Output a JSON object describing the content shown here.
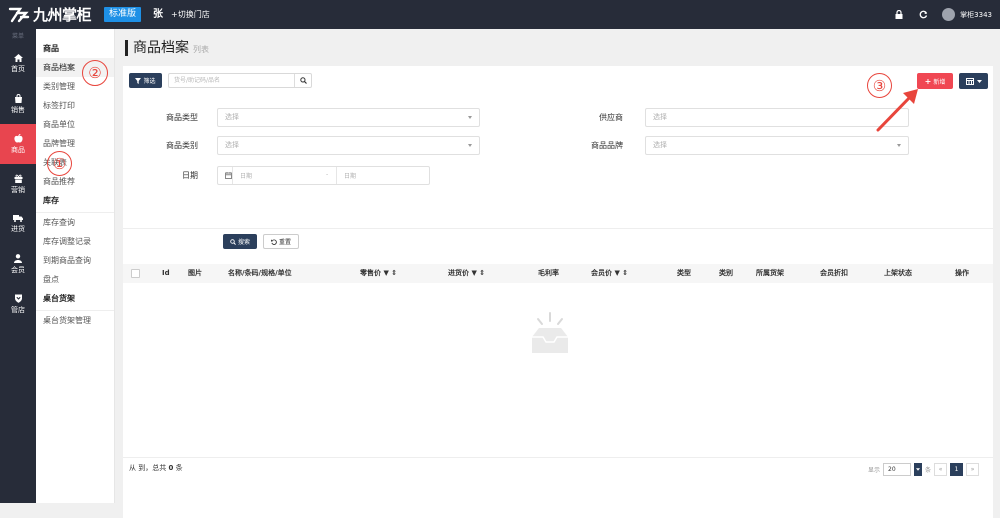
{
  "header": {
    "logo_text": "九州掌柜",
    "edition": "标准版",
    "user": "张",
    "switch_store": "+切换门店",
    "account": "掌柜3343",
    "icons": [
      "lock-icon",
      "refresh-icon",
      "avatar"
    ]
  },
  "left_nav": {
    "header": "菜单",
    "items": [
      {
        "label": "首页",
        "icon": "home-icon"
      },
      {
        "label": "销售",
        "icon": "sale-icon"
      },
      {
        "label": "商品",
        "icon": "apple-icon",
        "active": true
      },
      {
        "label": "营销",
        "icon": "gift-icon"
      },
      {
        "label": "进货",
        "icon": "truck-icon"
      },
      {
        "label": "会员",
        "icon": "user-icon"
      },
      {
        "label": "管店",
        "icon": "shield-icon"
      }
    ]
  },
  "sub_nav": {
    "sections": [
      {
        "title": "商品",
        "items": [
          "商品档案",
          "类别管理",
          "标签打印",
          "商品单位",
          "品牌管理",
          "关联表",
          "商品推荐"
        ]
      },
      {
        "title": "库存",
        "items": [
          "库存查询",
          "库存调整记录",
          "到期商品查询",
          "盘点"
        ]
      },
      {
        "title": "桌台货架",
        "items": [
          "桌台货架管理"
        ]
      }
    ],
    "active": "商品档案"
  },
  "page": {
    "title": "商品档案",
    "subtitle": "列表"
  },
  "toolbar": {
    "filter_label": "筛选",
    "search_placeholder": "货号/助记码/品名",
    "add_label": "新增"
  },
  "filters": {
    "product_type_label": "商品类型",
    "product_type_value": "选择",
    "supplier_label": "供应商",
    "supplier_value": "选择",
    "category_label": "商品类别",
    "category_value": "选择",
    "brand_label": "商品品牌",
    "brand_value": "选择",
    "date_label": "日期",
    "date_start": "日期",
    "date_sep": "-",
    "date_end": "日期",
    "search_btn": "搜索",
    "reset_btn": "重置"
  },
  "table": {
    "columns": [
      "Id",
      "图片",
      "名称/条码/规格/单位",
      "零售价",
      "进货价",
      "毛利率",
      "会员价",
      "类型",
      "类别",
      "所属货架",
      "会员折扣",
      "上架状态",
      "操作"
    ]
  },
  "footer": {
    "summary_prefix": "从 到，总共",
    "total": "0",
    "summary_suffix": "条",
    "per_page_label": "显示",
    "per_page_value": "20",
    "per_page_unit": "条",
    "page_prev": "«",
    "page_current": "1",
    "page_next": "»"
  },
  "annotations": [
    "①",
    "②",
    "③"
  ],
  "colors": {
    "dark": "#272c39",
    "navy": "#2b3f5c",
    "red": "#f04753",
    "annotation": "#e8453c",
    "edition_blue": "#1e90e6"
  }
}
